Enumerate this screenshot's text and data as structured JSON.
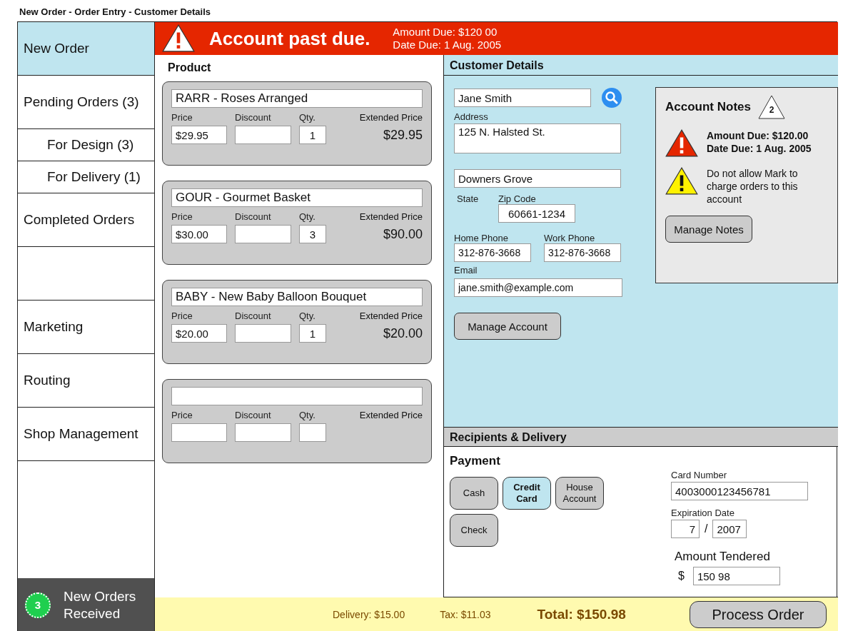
{
  "window": {
    "title": "New Order - Order Entry - Customer Details"
  },
  "sidebar": {
    "items": [
      {
        "kind": "item",
        "label": "New Order",
        "selected": true
      },
      {
        "kind": "item",
        "label": "Pending Orders (3)",
        "selected": false,
        "children": [
          {
            "kind": "sub",
            "label": "For Design (3)",
            "selected": false
          },
          {
            "kind": "sub",
            "label": "For Delivery (1)",
            "selected": false
          }
        ]
      },
      {
        "kind": "item",
        "label": "Completed Orders",
        "selected": false
      },
      {
        "kind": "blank"
      },
      {
        "kind": "item",
        "label": "Marketing",
        "selected": false
      },
      {
        "kind": "item",
        "label": "Routing",
        "selected": false
      },
      {
        "kind": "item",
        "label": "Shop Management",
        "selected": false
      }
    ],
    "notification": {
      "count": "3",
      "text": "New Orders Received"
    }
  },
  "banner": {
    "title": "Account past due.",
    "amount_due": "Amount Due: $120 00",
    "date_due": "Date Due: 1 Aug. 2005"
  },
  "product": {
    "title": "Product",
    "items": [
      {
        "name": "RARR - Roses Arranged",
        "price_label": "Price",
        "price": "$29.95",
        "discount_label": "Discount",
        "qty_label": "Qty.",
        "qty": "1",
        "extended_label": "Extended Price",
        "extended_price": "$29.95"
      },
      {
        "name": "GOUR - Gourmet Basket",
        "price_label": "Price",
        "price": "$30.00",
        "discount_label": "Discount",
        "qty_label": "Qty.",
        "qty": "3",
        "extended_label": "Extended Price",
        "extended_price": "$90.00"
      },
      {
        "name": "BABY - New Baby Balloon Bouquet",
        "price_label": "Price",
        "price": "$20.00",
        "discount_label": "Discount",
        "qty_label": "Qty.",
        "qty": "1",
        "extended_label": "Extended Price",
        "extended_price": "$20.00"
      },
      {
        "price_label": "Price",
        "discount_label": "Discount",
        "qty_label": "Qty.",
        "extended_label": "Extended Price"
      }
    ]
  },
  "customer": {
    "title": "Customer Details",
    "name": "Jane Smith",
    "address_label": "Address",
    "address": "125 N. Halsted St.",
    "city": "Downers Grove",
    "state_label": "State",
    "zip_label": "Zip Code",
    "zip": "60661-1234",
    "home_phone_label": "Home Phone",
    "home_phone": "312-876-3668",
    "work_phone_label": "Work Phone",
    "work_phone": "312-876-3668",
    "email_label": "Email",
    "email": "jane.smith@example.com",
    "manage_button": "Manage Account",
    "notes": {
      "title": "Account Notes",
      "count": "2",
      "items": [
        {
          "kind": "alert",
          "lines": [
            "Amount Due: $120.00",
            "Date Due: 1 Aug. 2005"
          ]
        },
        {
          "kind": "warning",
          "lines": [
            "Do not allow Mark to charge orders to this account"
          ]
        }
      ],
      "manage_button": "Manage Notes"
    }
  },
  "recipients": {
    "title": "Recipients & Delivery"
  },
  "payment": {
    "title": "Payment",
    "methods": [
      {
        "label": "Cash",
        "selected": false
      },
      {
        "label": "Credit Card",
        "selected": true
      },
      {
        "label": "House Account",
        "selected": false
      },
      {
        "label": "Check",
        "selected": false
      }
    ],
    "card_number_label": "Card Number",
    "card_number": "4003000123456781",
    "expiration_label": "Expiration Date",
    "exp_month": "7",
    "exp_separator": "/",
    "exp_year": "2007",
    "tendered_label": "Amount Tendered",
    "currency": "$",
    "tendered": "150 98"
  },
  "footer": {
    "delivery": "Delivery: $15.00",
    "tax": "Tax: $11.03",
    "total": "Total: $150.98",
    "process_button": "Process Order"
  }
}
